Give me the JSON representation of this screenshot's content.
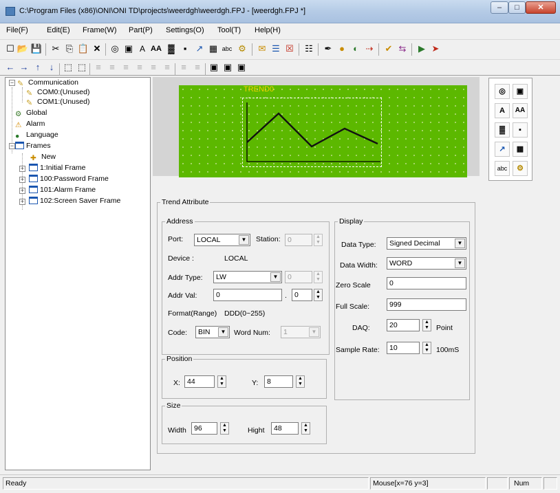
{
  "window": {
    "title": "C:\\Program Files (x86)\\ONI\\ONI TD\\projects\\weerdgh\\weerdgh.FPJ - [weerdgh.FPJ *]",
    "min_label": "–",
    "max_label": "□",
    "close_label": "✕"
  },
  "menu": [
    "File(F)",
    "Edit(E)",
    "Frame(W)",
    "Part(P)",
    "Settings(O)",
    "Tool(T)",
    "Help(H)"
  ],
  "toolbar1": [
    "☐",
    "📂",
    "💾",
    "✂",
    "⎘",
    "📋",
    "✕",
    "◎",
    "▣",
    "A",
    "AA",
    "▓",
    "▪",
    "↗",
    "▦",
    "abc",
    "⚙",
    "✉",
    "☰",
    "☒",
    "☷",
    "✒",
    "●",
    "◐",
    "⇢",
    "✔",
    "⇆",
    "▶",
    "➤"
  ],
  "toolbar2": [
    "←",
    "→",
    "↑",
    "↓",
    "⬚",
    "⬚",
    "≡",
    "≡",
    "≡",
    "≡",
    "≡",
    "≡",
    "≡",
    "≡",
    "▣",
    "▣",
    "▣"
  ],
  "tree": {
    "communication": "Communication",
    "com0": "COM0:(Unused)",
    "com1": "COM1:(Unused)",
    "global": "Global",
    "alarm": "Alarm",
    "language": "Language",
    "frames": "Frames",
    "new": "New",
    "frame1": "1:Initial Frame",
    "frame100": "100:Password Frame",
    "frame101": "101:Alarm Frame",
    "frame102": "102:Screen Saver Frame"
  },
  "canvas": {
    "trend_label": "TREND0"
  },
  "palette": [
    "◎",
    "▣",
    "A",
    "AA",
    "▓",
    "▪",
    "↗",
    "▦",
    "abc",
    "⚙"
  ],
  "trend_attribute": {
    "legend": "Trend Attribute",
    "address": {
      "legend": "Address",
      "port_label": "Port:",
      "port_value": "LOCAL",
      "station_label": "Station:",
      "station_value": "0",
      "device_label": "Device :",
      "device_value": "LOCAL",
      "addr_type_label": "Addr Type:",
      "addr_type_value": "LW",
      "addr_type_extra": "0",
      "addr_val_label": "Addr Val:",
      "addr_val_value": "0",
      "addr_val_dot": ".",
      "addr_val_extra": "0",
      "format_label": "Format(Range)",
      "format_value": "DDD(0~255)",
      "code_label": "Code:",
      "code_value": "BIN",
      "word_num_label": "Word Num:",
      "word_num_value": "1"
    },
    "position": {
      "legend": "Position",
      "x_label": "X:",
      "x_value": "44",
      "y_label": "Y:",
      "y_value": "8"
    },
    "size": {
      "legend": "Size",
      "width_label": "Width",
      "width_value": "96",
      "height_label": "Hight",
      "height_value": "48"
    },
    "display": {
      "legend": "Display",
      "data_type_label": "Data Type:",
      "data_type_value": "Signed Decimal",
      "data_width_label": "Data Width:",
      "data_width_value": "WORD",
      "zero_scale_label": "Zero Scale",
      "zero_scale_value": "0",
      "full_scale_label": "Full Scale:",
      "full_scale_value": "999",
      "daq_label": "DAQ:",
      "daq_value": "20",
      "daq_unit": "Point",
      "sample_rate_label": "Sample Rate:",
      "sample_rate_value": "10",
      "sample_rate_unit": "100mS"
    }
  },
  "status": {
    "ready": "Ready",
    "mouse": "Mouse[x=76  y=3]",
    "num": "Num"
  }
}
